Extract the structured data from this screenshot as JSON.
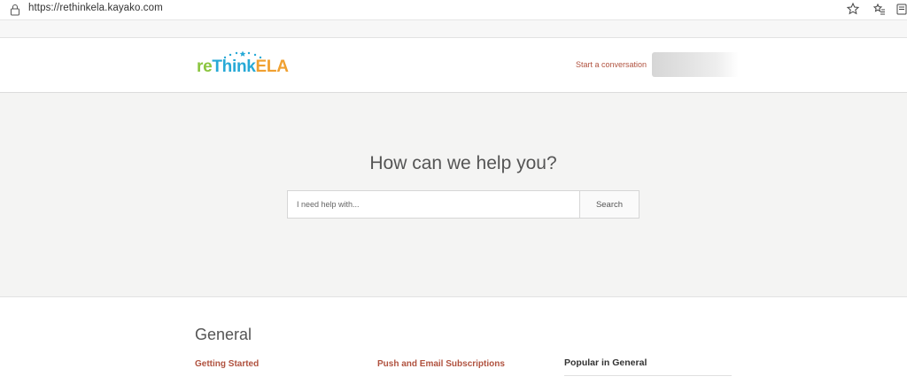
{
  "browser": {
    "url": "https://rethinkela.kayako.com",
    "icons": [
      "lock-icon",
      "star-icon",
      "favorites-icon",
      "collections-icon"
    ]
  },
  "header": {
    "logo": {
      "part1": "re",
      "part2": "Think",
      "part3": "ELA"
    },
    "start_conversation": "Start a conversation"
  },
  "hero": {
    "title": "How can we help you?",
    "search_placeholder": "I need help with...",
    "search_button": "Search"
  },
  "content": {
    "section_title": "General",
    "categories": [
      {
        "label": "Getting Started"
      },
      {
        "label": "Push and Email Subscriptions"
      }
    ],
    "popular_title": "Popular in General"
  },
  "colors": {
    "accent_link": "#b0523f",
    "hero_bg": "#f4f4f3",
    "logo_green": "#8bc53f",
    "logo_blue": "#27a9d6",
    "logo_orange": "#f0a030"
  }
}
